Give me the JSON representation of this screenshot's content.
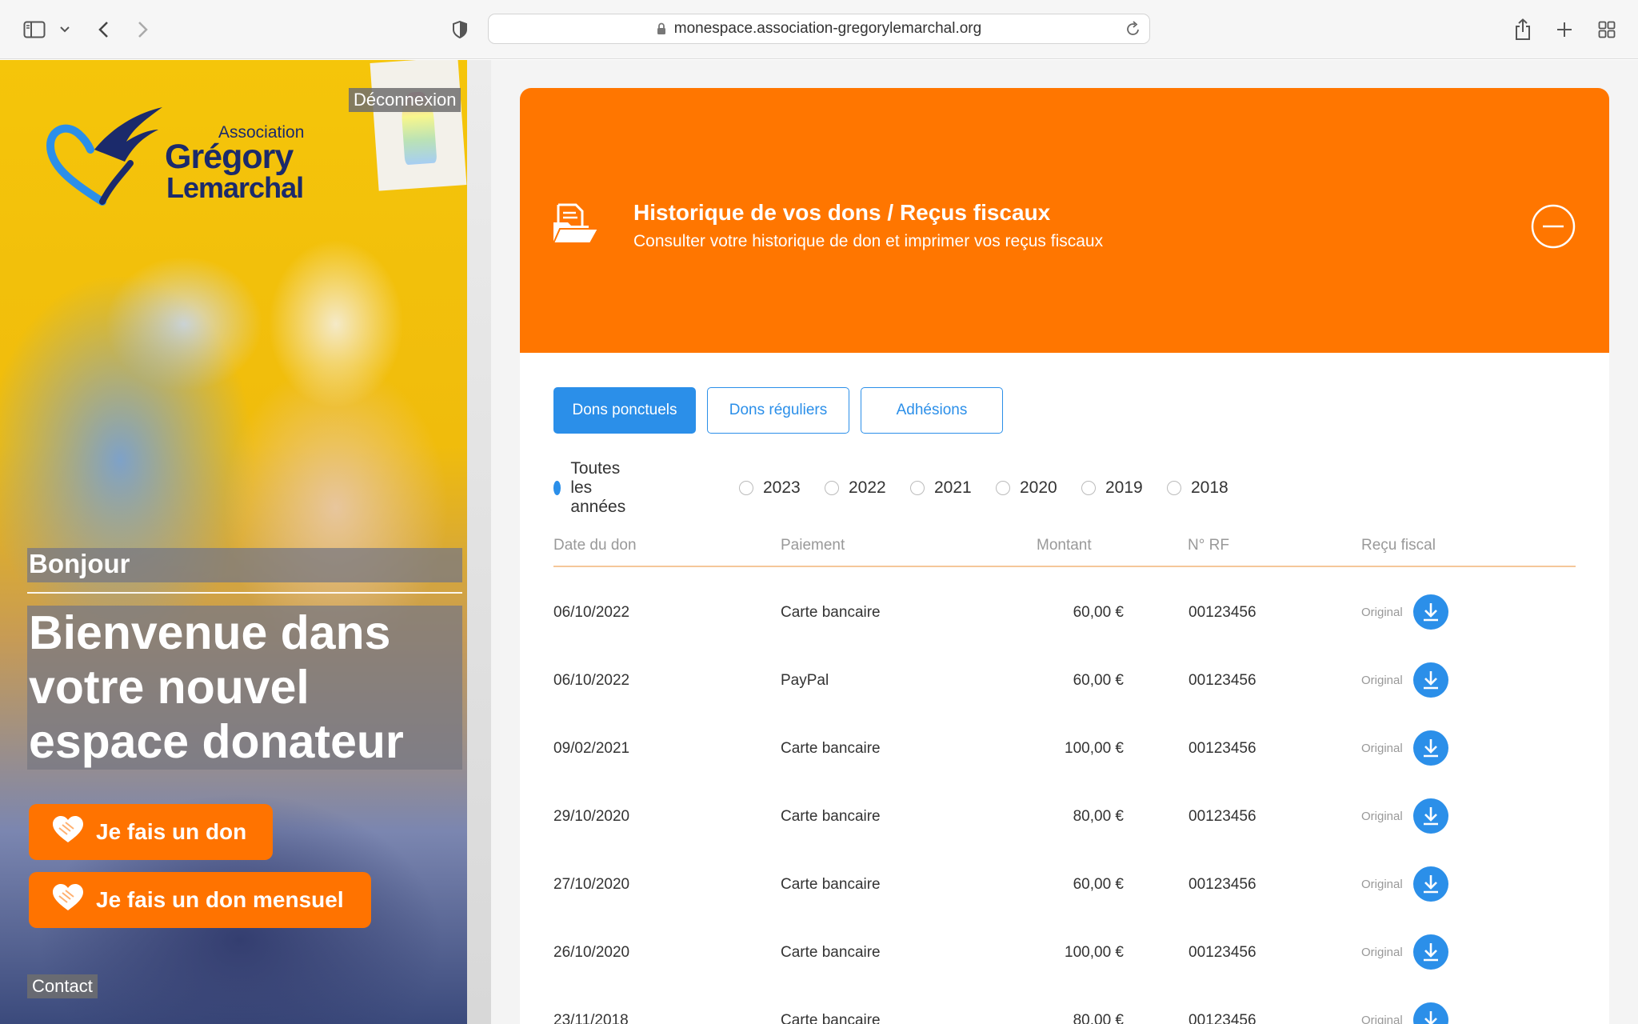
{
  "browser": {
    "url": "monespace.association-gregorylemarchal.org",
    "icons": [
      "sidebar-icon",
      "chevron-down-icon",
      "back-icon",
      "forward-icon",
      "shield-icon",
      "lock-icon",
      "reload-icon",
      "share-icon",
      "plus-icon",
      "tabs-grid-icon"
    ]
  },
  "hero": {
    "logo": {
      "line1": "Association",
      "line2": "Grégory",
      "line3": "Lemarchal"
    },
    "logout": "Déconnexion",
    "greeting": "Bonjour",
    "welcome": "Bienvenue dans votre nouvel espace donateur",
    "cta_donate": "Je fais un don",
    "cta_monthly": "Je fais un don mensuel",
    "contact": "Contact"
  },
  "card": {
    "title": "Historique de vos dons / Reçus fiscaux",
    "subtitle": "Consulter votre historique de don et imprimer vos reçus fiscaux",
    "tabs": [
      "Dons ponctuels",
      "Dons réguliers",
      "Adhésions"
    ],
    "active_tab": 0,
    "years": [
      "Toutes les années",
      "2023",
      "2022",
      "2021",
      "2020",
      "2019",
      "2018"
    ],
    "selected_year": 0,
    "columns": [
      "Date du don",
      "Paiement",
      "Montant",
      "N° RF",
      "Reçu fiscal"
    ],
    "receipt_label": "Original",
    "rows": [
      [
        "06/10/2022",
        "Carte bancaire",
        "60,00 €",
        "00123456"
      ],
      [
        "06/10/2022",
        "PayPal",
        "60,00 €",
        "00123456"
      ],
      [
        "09/02/2021",
        "Carte bancaire",
        "100,00 €",
        "00123456"
      ],
      [
        "29/10/2020",
        "Carte bancaire",
        "80,00 €",
        "00123456"
      ],
      [
        "27/10/2020",
        "Carte bancaire",
        "60,00 €",
        "00123456"
      ],
      [
        "26/10/2020",
        "Carte bancaire",
        "100,00 €",
        "00123456"
      ],
      [
        "23/11/2018",
        "Carte bancaire",
        "80,00 €",
        "00123456"
      ]
    ]
  },
  "colors": {
    "accent_orange": "#ff7600",
    "accent_blue": "#2b8fe9",
    "divider": "#f5c79a"
  }
}
